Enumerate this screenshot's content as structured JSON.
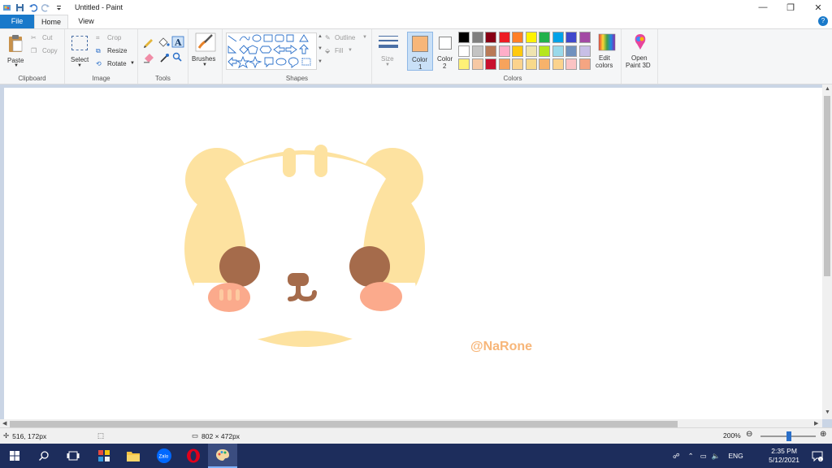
{
  "window": {
    "title": "Untitled - Paint",
    "controls": {
      "minimize": "—",
      "maximize": "❐",
      "close": "✕"
    }
  },
  "tabs": {
    "file": "File",
    "home": "Home",
    "view": "View"
  },
  "ribbon": {
    "clipboard": {
      "paste": "Paste",
      "cut": "Cut",
      "copy": "Copy",
      "label": "Clipboard"
    },
    "image": {
      "select": "Select",
      "crop": "Crop",
      "resize": "Resize",
      "rotate": "Rotate",
      "label": "Image"
    },
    "tools": {
      "label": "Tools"
    },
    "brushes": {
      "label": "Brushes"
    },
    "shapes": {
      "outline": "Outline",
      "fill": "Fill",
      "label": "Shapes"
    },
    "size": {
      "label": "Size"
    },
    "color1": {
      "label": "Color",
      "num": "1",
      "value": "#f7b679"
    },
    "color2": {
      "label": "Color",
      "num": "2",
      "value": "#ffffff"
    },
    "colors": {
      "label": "Colors",
      "row1": [
        "#000000",
        "#7f7f7f",
        "#880015",
        "#ed1c24",
        "#ff7f27",
        "#fff200",
        "#22b14c",
        "#00a2e8",
        "#3f48cc",
        "#a349a4"
      ],
      "row2": [
        "#ffffff",
        "#c3c3c3",
        "#b97a57",
        "#ffaec9",
        "#ffc90e",
        "#efe4b0",
        "#b5e61d",
        "#99d9ea",
        "#7092be",
        "#c8bfe7"
      ],
      "row3": [
        "#fff176",
        "#f6c8a4",
        "#c8102e",
        "#f7a35c",
        "#fbd38d",
        "#f8d98a",
        "#f6b26b",
        "#fbd38d",
        "#fbc4c4",
        "#f4a582"
      ]
    },
    "edit_colors": {
      "line1": "Edit",
      "line2": "colors"
    },
    "paint3d": {
      "line1": "Open",
      "line2": "Paint 3D"
    }
  },
  "canvas": {
    "watermark": "@NaRone"
  },
  "status": {
    "cursor": "516, 172px",
    "size": "802 × 472px",
    "zoom": "200%"
  },
  "taskbar": {
    "lang": "ENG",
    "time": "2:35 PM",
    "date": "5/12/2021"
  }
}
